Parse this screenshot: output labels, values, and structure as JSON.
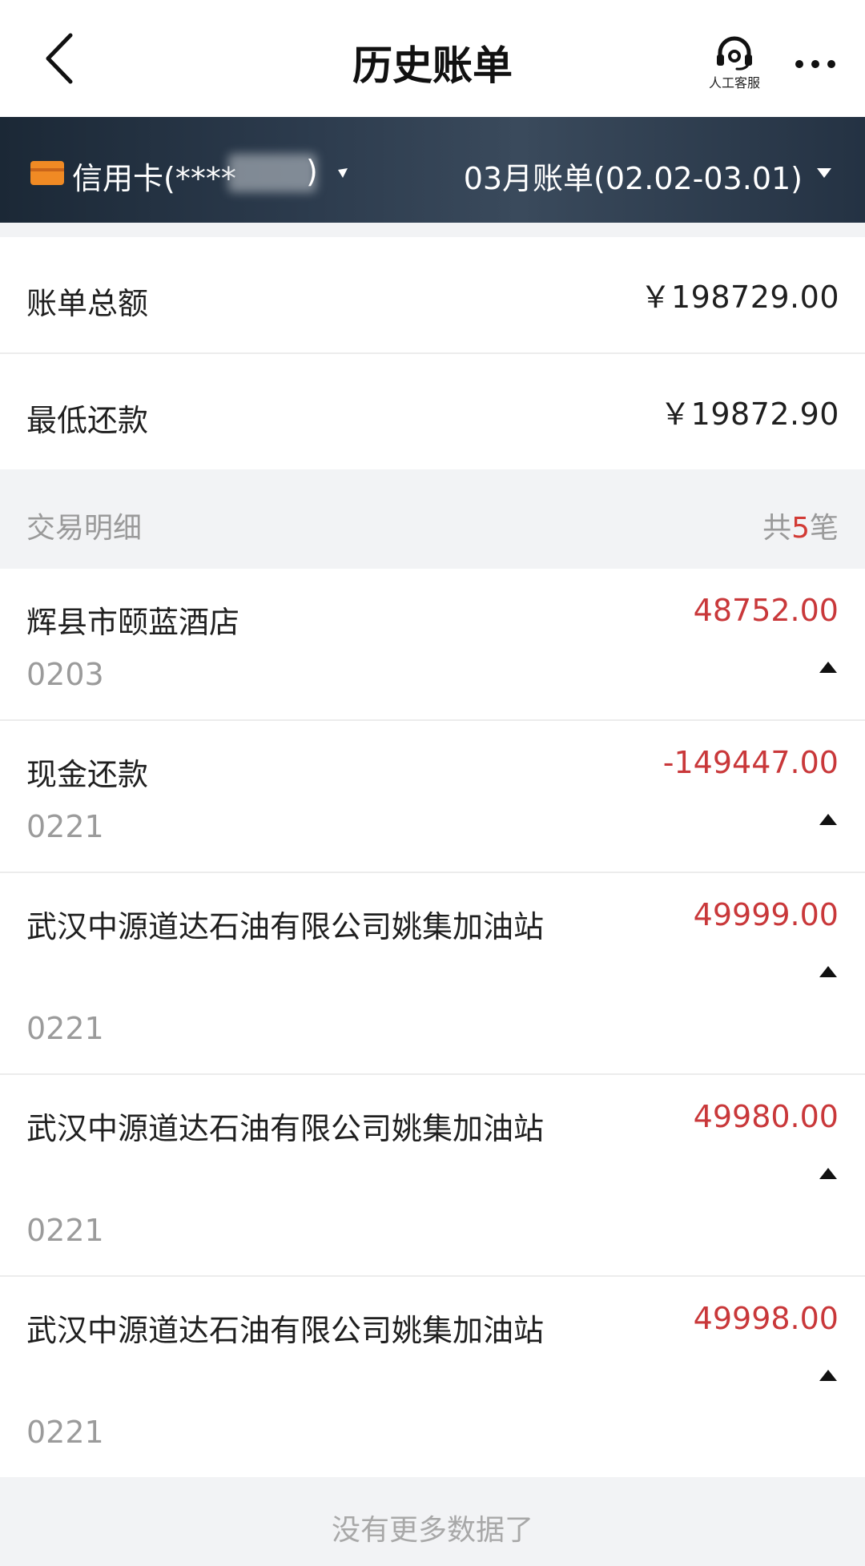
{
  "nav": {
    "title": "历史账单",
    "customer_service_label": "人工客服"
  },
  "card_bar": {
    "card_label": "信用卡(****",
    "card_close_paren": ")",
    "bill_period": "03月账单(02.02-03.01)",
    "card_color": "#f08a24"
  },
  "summary": {
    "total_label": "账单总额",
    "total_value": "￥198729.00",
    "min_label": "最低还款",
    "min_value": "￥19872.90"
  },
  "details": {
    "header_label": "交易明细",
    "count_prefix": "共",
    "count_num": "5",
    "count_suffix": "笔"
  },
  "transactions": [
    {
      "merchant": "辉县市颐蓝酒店",
      "date": "0203",
      "amount": "48752.00"
    },
    {
      "merchant": "现金还款",
      "date": "0221",
      "amount": "-149447.00"
    },
    {
      "merchant": "武汉中源道达石油有限公司姚集加油站",
      "date": "0221",
      "amount": "49999.00"
    },
    {
      "merchant": "武汉中源道达石油有限公司姚集加油站",
      "date": "0221",
      "amount": "49980.00"
    },
    {
      "merchant": "武汉中源道达石油有限公司姚集加油站",
      "date": "0221",
      "amount": "49998.00"
    }
  ],
  "footer": {
    "message": "没有更多数据了"
  },
  "colors": {
    "amount_red": "#c9383a",
    "count_red": "#d23b35",
    "header_dark": "#243243"
  }
}
